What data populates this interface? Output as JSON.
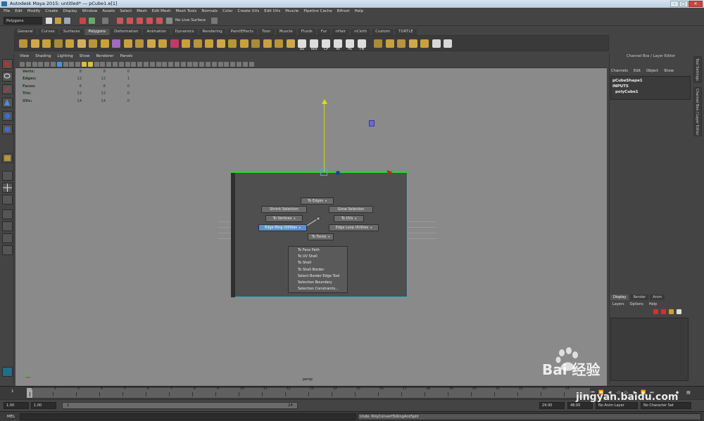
{
  "window": {
    "title": "Autodesk Maya 2015: untitled*   ---   pCube1.e[1]"
  },
  "menubar": [
    "File",
    "Edit",
    "Modify",
    "Create",
    "Display",
    "Window",
    "Assets",
    "Select",
    "Mesh",
    "Edit Mesh",
    "Mesh Tools",
    "Normals",
    "Color",
    "Create UVs",
    "Edit UVs",
    "Muscle",
    "Pipeline Cache",
    "Bifrost",
    "Help"
  ],
  "statusline": {
    "mode": "Polygons",
    "live_surface": "No Live Surface"
  },
  "shelf_tabs": [
    "General",
    "Curves",
    "Surfaces",
    "Polygons",
    "Deformation",
    "Animation",
    "Dynamics",
    "Rendering",
    "PaintEffects",
    "Toon",
    "Muscle",
    "Fluids",
    "Fur",
    "nHair",
    "nCloth",
    "Custom",
    "TURTLE"
  ],
  "shelf_active_tab": "Polygons",
  "shelf_text_icons": [
    "DS",
    "Hist",
    "CP",
    "All",
    "PS",
    "FN"
  ],
  "viewport_menu": [
    "View",
    "Shading",
    "Lighting",
    "Show",
    "Renderer",
    "Panels"
  ],
  "hud": {
    "rows": [
      {
        "label": "Verts:",
        "a": "8",
        "b": "8",
        "c": "0"
      },
      {
        "label": "Edges:",
        "a": "12",
        "b": "12",
        "c": "1"
      },
      {
        "label": "Faces:",
        "a": "6",
        "b": "6",
        "c": "0"
      },
      {
        "label": "Tris:",
        "a": "12",
        "b": "12",
        "c": "0"
      },
      {
        "label": "UVs:",
        "a": "14",
        "b": "14",
        "c": "0"
      }
    ]
  },
  "marking_menu": {
    "to_edges": "To Edges",
    "shrink": "Shrink Selection",
    "grow": "Grow Selection",
    "to_vertices": "To Vertices",
    "to_uvs": "To UVs",
    "edge_ring": "Edge Ring Utilities",
    "edge_loop": "Edge Loop Utilities",
    "to_faces": "To Faces",
    "submenu": [
      "To Face Path",
      "To UV Shell",
      "To Shell",
      "To Shell Border",
      "Select Border Edge Tool",
      "Selection Boundary",
      "Selection Constraints..."
    ]
  },
  "viewport_label": "persp",
  "channel_box": {
    "title": "Channel Box / Layer Editor",
    "menu": [
      "Channels",
      "Edit",
      "Object",
      "Show"
    ],
    "shape": "pCubeShape1",
    "inputs": "INPUTS",
    "node": "polyCube1"
  },
  "layer_editor": {
    "tabs": [
      "Display",
      "Render",
      "Anim"
    ],
    "active": "Display",
    "menu": [
      "Layers",
      "Options",
      "Help"
    ]
  },
  "side_tabs": [
    "Tool Settings",
    "Channel Box / Layer Editor"
  ],
  "timeslider": {
    "current": "1",
    "ticks": [
      "1",
      "2",
      "3",
      "4",
      "5",
      "6",
      "7",
      "8",
      "9",
      "10",
      "11",
      "12",
      "13",
      "14",
      "15",
      "16",
      "17",
      "18",
      "19",
      "20",
      "21",
      "22",
      "23",
      "24"
    ]
  },
  "range": {
    "start": "1.00",
    "current": "1.00",
    "range_start": "1",
    "range_end": "24",
    "end": "24.00",
    "anim_end": "48.00",
    "anim_layer": "No Anim Layer",
    "char_set": "No Character Set"
  },
  "cmdline": {
    "lang": "MEL",
    "result": "Undo: PolyConvertToRingAndSplit"
  },
  "watermark": {
    "brand": "Bai  经验",
    "url": "jingyan.baidu.com"
  }
}
